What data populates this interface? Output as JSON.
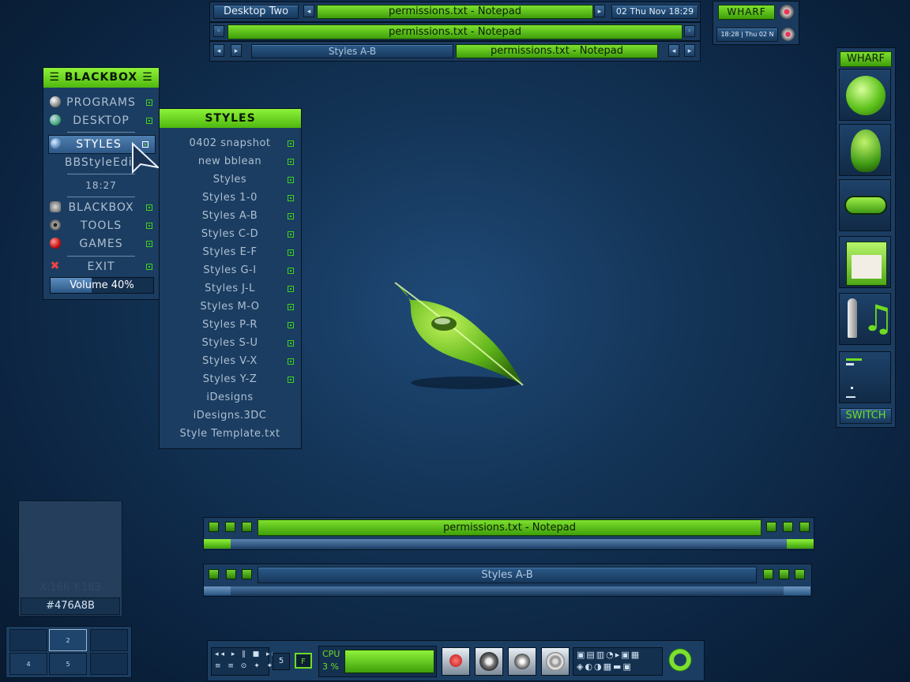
{
  "top_toolbar": {
    "workspace": "Desktop Two",
    "window_title": "permissions.txt - Notepad",
    "clock": "02 Thu Nov 18:29"
  },
  "top_titlebar": {
    "title": "permissions.txt - Notepad"
  },
  "top_iconbar": {
    "items": [
      "Styles A-B",
      "permissions.txt - Notepad"
    ]
  },
  "wharf_top": {
    "label": "WHARF",
    "clock": "18:28 | Thu 02 N"
  },
  "blackbox_menu": {
    "title": "BLACKBOX",
    "items": {
      "programs": "PROGRAMS",
      "desktop": "DESKTOP",
      "styles": "STYLES",
      "bbstyleedit": "BBStyleEdit",
      "time": "18:27",
      "blackbox": "BLACKBOX",
      "tools": "TOOLS",
      "games": "GAMES",
      "exit": "EXIT"
    },
    "volume": "Volume 40%",
    "volume_level": 0.4
  },
  "styles_menu": {
    "title": "STYLES",
    "items": [
      "0402 snapshot",
      "new bblean",
      "Styles",
      "Styles 1-0",
      "Styles A-B",
      "Styles C-D",
      "Styles E-F",
      "Styles G-I",
      "Styles J-L",
      "Styles M-O",
      "Styles P-R",
      "Styles S-U",
      "Styles V-X",
      "Styles Y-Z",
      "iDesigns",
      "iDesigns.3DC",
      "Style Template.txt"
    ]
  },
  "wharf_dock": {
    "label": "WHARF",
    "switch": "SWITCH"
  },
  "window_active": {
    "title": "permissions.txt - Notepad"
  },
  "window_inactive": {
    "title": "Styles A-B"
  },
  "color_picker": {
    "coords": "X:166 Y:183",
    "hex": "#476A8B"
  },
  "pager": {
    "desks": [
      "",
      "2",
      "",
      "4",
      "5",
      ""
    ]
  },
  "bottom_bar": {
    "ws_number": "5",
    "f_label": "F",
    "cpu_label": "CPU",
    "cpu_value": "3 %",
    "cpu_level": 0.03
  },
  "colors": {
    "accent": "#6fdc22",
    "background": "#0c2542",
    "panel": "#1b3d62"
  }
}
